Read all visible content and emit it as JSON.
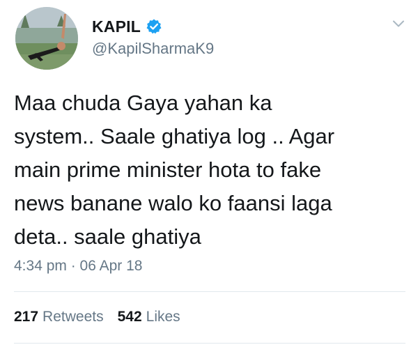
{
  "user": {
    "display_name": "KAPIL",
    "handle": "@KapilSharmaK9",
    "verified": true,
    "avatar_icon": "profile-photo"
  },
  "tweet": {
    "text": "Maa chuda Gaya yahan ka\nsystem.. Saale ghatiya log .. Agar\nmain prime minister hota to fake\nnews banane walo ko faansi laga\ndeta.. saale ghatiya",
    "timestamp": "4:34 pm · 06 Apr 18"
  },
  "stats": {
    "retweets_count": "217",
    "retweets_label": "Retweets",
    "likes_count": "542",
    "likes_label": "Likes"
  },
  "colors": {
    "text": "#14171a",
    "secondary": "#657786",
    "verified": "#1da1f2",
    "divider": "#e1e8ed"
  },
  "icons": {
    "verified": "verified-badge-icon",
    "menu": "chevron-down-icon"
  }
}
